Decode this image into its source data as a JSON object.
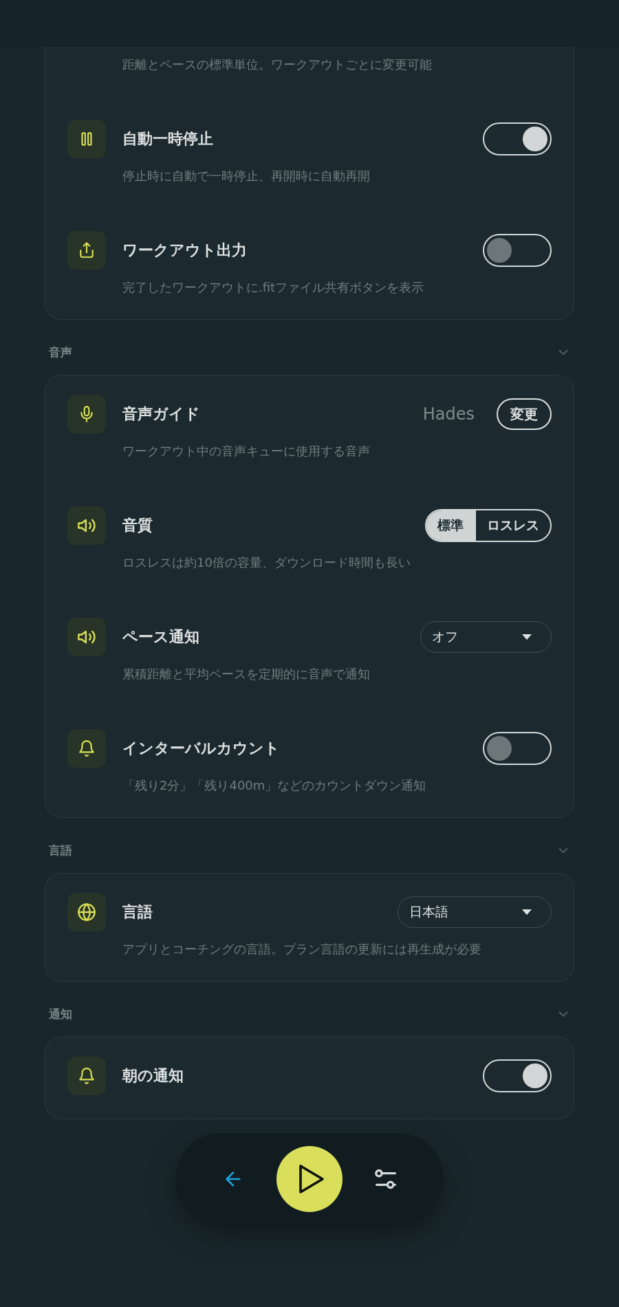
{
  "sections": [
    {
      "rows": [
        {
          "kind": "tail",
          "description": "距離とペースの標準単位。ワークアウトごとに変更可能"
        },
        {
          "kind": "toggle",
          "title": "自動一時停止",
          "description": "停止時に自動で一時停止、再開時に自動再開",
          "on": true
        },
        {
          "kind": "toggle",
          "title": "ワークアウト出力",
          "description": "完了したワークアウトに.fitファイル共有ボタンを表示",
          "on": false
        }
      ]
    },
    {
      "title": "音声",
      "rows": [
        {
          "kind": "voice",
          "title": "音声ガイド",
          "value": "Hades",
          "button": "変更",
          "description": "ワークアウト中の音声キューに使用する音声"
        },
        {
          "kind": "segmented",
          "title": "音質",
          "options": [
            {
              "label": "標準",
              "selected": true
            },
            {
              "label": "ロスレス",
              "selected": false
            }
          ],
          "description": "ロスレスは約10倍の容量、ダウンロード時間も長い"
        },
        {
          "kind": "select",
          "title": "ペース通知",
          "value": "オフ",
          "description": "累積距離と平均ペースを定期的に音声で通知"
        },
        {
          "kind": "toggle",
          "title": "インターバルカウント",
          "description": "「残り2分」「残り400m」などのカウントダウン通知",
          "on": false
        }
      ]
    },
    {
      "title": "言語",
      "rows": [
        {
          "kind": "select",
          "title": "言語",
          "value": "日本語",
          "description": "アプリとコーチングの言語。プラン言語の更新には再生成が必要",
          "wide": true
        }
      ]
    },
    {
      "title": "通知",
      "rows": [
        {
          "kind": "toggle",
          "title": "朝の通知",
          "on": true
        }
      ]
    }
  ]
}
